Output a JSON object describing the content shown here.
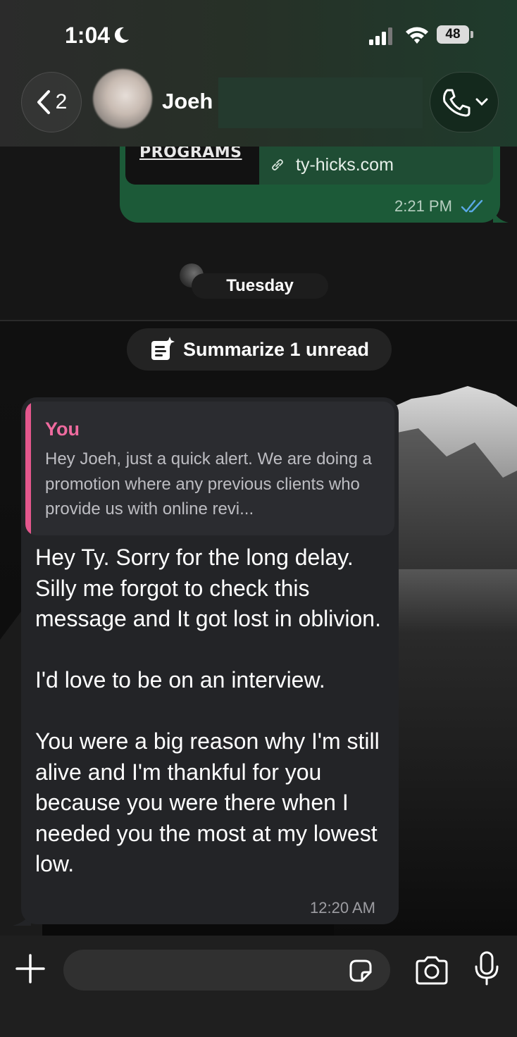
{
  "status_bar": {
    "time": "1:04",
    "battery": "48"
  },
  "header": {
    "back_count": "2",
    "contact_name": "Joeh"
  },
  "outgoing_message": {
    "preview_title": "PROGRAMS",
    "link_domain": "ty-hicks.com",
    "time": "2:21 PM",
    "status": "read"
  },
  "date_divider": "Tuesday",
  "summarize": {
    "label": "Summarize 1 unread"
  },
  "incoming_message": {
    "quote_author": "You",
    "quote_text": "Hey Joeh, just a quick alert. We are doing a promotion where any previous clients who provide us with online revi...",
    "text": "Hey Ty. Sorry for the long delay. Silly me forgot to check this message and It got lost in oblivion.\n\nI'd love to be on an interview.\n\nYou were a big reason why I'm still alive and I'm thankful for you because you were there when I needed you the most at my lowest low.",
    "time": "12:20 AM"
  },
  "composer": {
    "placeholder": ""
  },
  "colors": {
    "outgoing_bubble": "#1c5a38",
    "incoming_bubble": "#232427",
    "quote_accent": "#e4578d",
    "read_ticks": "#5aa9e6"
  },
  "icons": [
    "moon-icon",
    "signal-icon",
    "wifi-icon",
    "battery-icon",
    "chevron-left-icon",
    "phone-icon",
    "chevron-down-icon",
    "link-icon",
    "double-check-icon",
    "summary-sparkle-icon",
    "plus-icon",
    "sticker-icon",
    "camera-icon",
    "microphone-icon"
  ]
}
